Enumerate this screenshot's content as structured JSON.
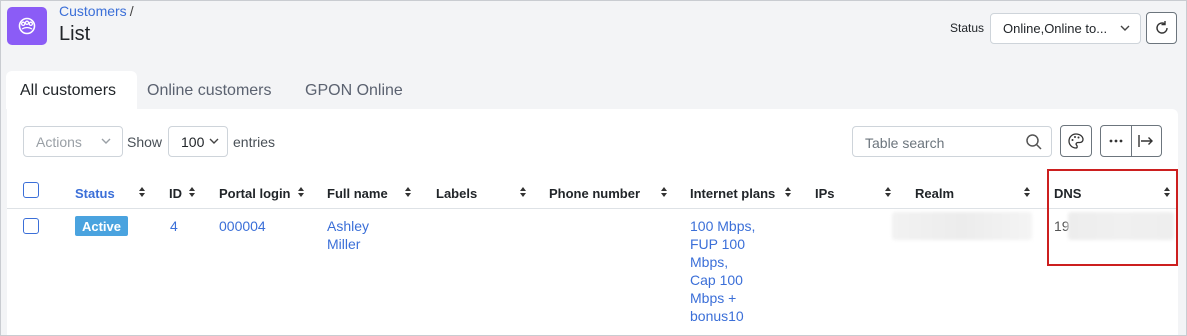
{
  "header": {
    "breadcrumb_parent": "Customers",
    "breadcrumb_sep": "/",
    "title": "List",
    "status_label": "Status",
    "status_value": "Online,Online to...",
    "app_icon": "users-group-icon",
    "brand_color": "#8b5cf6"
  },
  "tabs": [
    "All customers",
    "Online customers",
    "GPON Online"
  ],
  "toolbar": {
    "actions_label": "Actions",
    "show_label": "Show",
    "entries_value": "100",
    "entries_label": "entries",
    "search_placeholder": "Table search"
  },
  "table": {
    "columns": [
      "Status",
      "ID",
      "Portal login",
      "Full name",
      "Labels",
      "Phone number",
      "Internet plans",
      "IPs",
      "Realm",
      "DNS"
    ],
    "rows": [
      {
        "status": "Active",
        "id": "4",
        "portal_login": "000004",
        "full_name_line1": "Ashley",
        "full_name_line2": "Miller",
        "plans": [
          "100 Mbps,",
          "FUP 100",
          "Mbps,",
          "Cap 100",
          "Mbps +",
          "bonus10"
        ],
        "dns": "19"
      }
    ]
  },
  "colors": {
    "accent": "#3b6fd8",
    "status_active": "#4aa3df",
    "highlight": "#cc1f1f"
  }
}
